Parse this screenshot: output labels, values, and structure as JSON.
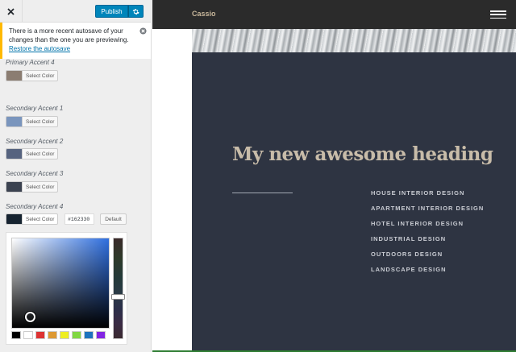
{
  "sidebar": {
    "close_icon": "close-icon",
    "publish_label": "Publish",
    "settings_icon": "gear-icon",
    "notice": {
      "text": "There is a more recent autosave of your changes than the one you are previewing.",
      "link": "Restore the autosave",
      "dismiss_icon": "circle-x-icon"
    },
    "controls": [
      {
        "label": "Primary Accent 4",
        "button": "Select Color",
        "swatch": "#8b7d71"
      },
      {
        "label": "Secondary Accent 1",
        "button": "Select Color",
        "swatch": "#7a95bd"
      },
      {
        "label": "Secondary Accent 2",
        "button": "Select Color",
        "swatch": "#56637f"
      },
      {
        "label": "Secondary Accent 3",
        "button": "Select Color",
        "swatch": "#3b4250"
      },
      {
        "label": "Secondary Accent 4",
        "button": "Select Color",
        "swatch": "#162330",
        "hex": "#162330",
        "default_label": "Default"
      }
    ],
    "picker": {
      "palette": [
        "#000000",
        "#ffffff",
        "#dd3333",
        "#dd9933",
        "#eeee22",
        "#81d742",
        "#1e73be",
        "#8224e3"
      ]
    }
  },
  "preview": {
    "site_title": "Cassio",
    "menu_icon": "hamburger-icon",
    "heading": "My new awesome heading",
    "services": [
      "HOUSE INTERIOR DESIGN",
      "APARTMENT INTERIOR DESIGN",
      "HOTEL INTERIOR DESIGN",
      "INDUSTRIAL DESIGN",
      "OUTDOORS DESIGN",
      "LANDSCAPE DESIGN"
    ]
  }
}
